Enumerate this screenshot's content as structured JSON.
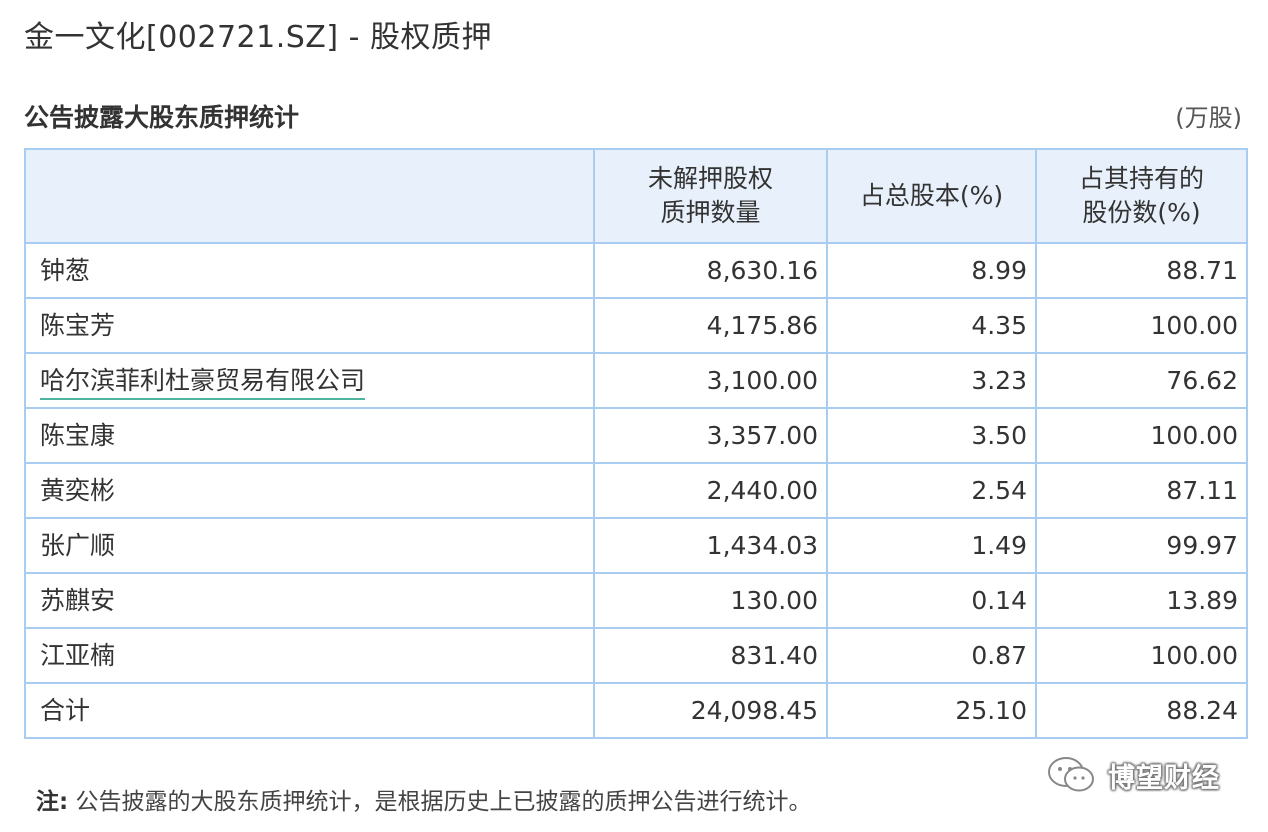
{
  "header": {
    "title": "金一文化[002721.SZ] - 股权质押"
  },
  "section": {
    "title": "公告披露大股东质押统计",
    "unit": "(万股)"
  },
  "table": {
    "columns": [
      "",
      "未解押股权\n质押数量",
      "占总股本(%)",
      "占其持有的\n股份数(%)"
    ],
    "rows": [
      {
        "name": "钟葱",
        "qty": "8,630.16",
        "pct_total": "8.99",
        "pct_held": "88.71"
      },
      {
        "name": "陈宝芳",
        "qty": "4,175.86",
        "pct_total": "4.35",
        "pct_held": "100.00"
      },
      {
        "name": "哈尔滨菲利杜豪贸易有限公司",
        "qty": "3,100.00",
        "pct_total": "3.23",
        "pct_held": "76.62"
      },
      {
        "name": "陈宝康",
        "qty": "3,357.00",
        "pct_total": "3.50",
        "pct_held": "100.00"
      },
      {
        "name": "黄奕彬",
        "qty": "2,440.00",
        "pct_total": "2.54",
        "pct_held": "87.11"
      },
      {
        "name": "张广顺",
        "qty": "1,434.03",
        "pct_total": "1.49",
        "pct_held": "99.97"
      },
      {
        "name": "苏麒安",
        "qty": "130.00",
        "pct_total": "0.14",
        "pct_held": "13.89"
      },
      {
        "name": "江亚楠",
        "qty": "831.40",
        "pct_total": "0.87",
        "pct_held": "100.00"
      },
      {
        "name": "合计",
        "qty": "24,098.45",
        "pct_total": "25.10",
        "pct_held": "88.24"
      }
    ]
  },
  "footnote": {
    "label": "注:",
    "text": "公告披露的大股东质押统计，是根据历史上已披露的质押公告进行统计。"
  },
  "watermark": {
    "icon": "wechat-icon",
    "text": "博望财经"
  },
  "colors": {
    "header_bg": "#e8f1fb",
    "border": "#a8cdf0",
    "link_underline": "#4fb3a0"
  }
}
